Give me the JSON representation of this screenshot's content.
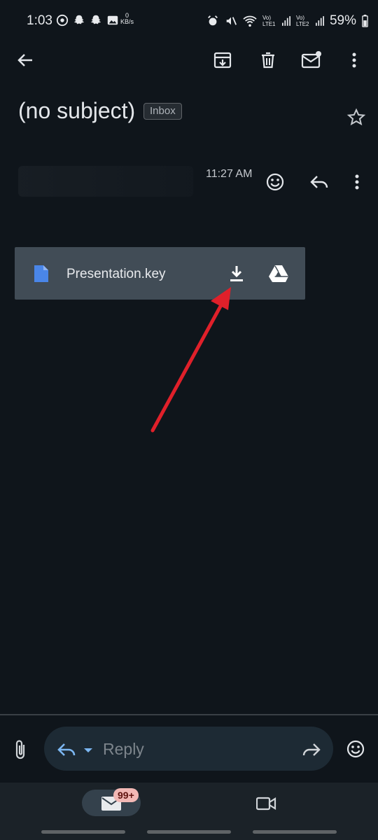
{
  "status_bar": {
    "time": "1:03",
    "data_speed_value": "0",
    "data_speed_unit": "KB/s",
    "sim1": "Vo) LTE1",
    "sim2": "Vo) LTE2",
    "battery": "59%"
  },
  "toolbar": {
    "icons": [
      "back-arrow-icon",
      "archive-icon",
      "delete-icon",
      "mark-unread-icon",
      "more-vert-icon"
    ]
  },
  "email": {
    "subject": "(no subject)",
    "label": "Inbox",
    "time": "11:27 AM"
  },
  "attachment": {
    "filename": "Presentation.key"
  },
  "reply_bar": {
    "placeholder": "Reply"
  },
  "bottom_nav": {
    "mail_badge": "99+"
  },
  "colors": {
    "background": "#0f151b",
    "attachment_card": "#414c56",
    "annotation_arrow": "#e0202a",
    "doc_icon": "#4a86e8",
    "badge": "#f2b8b5"
  }
}
